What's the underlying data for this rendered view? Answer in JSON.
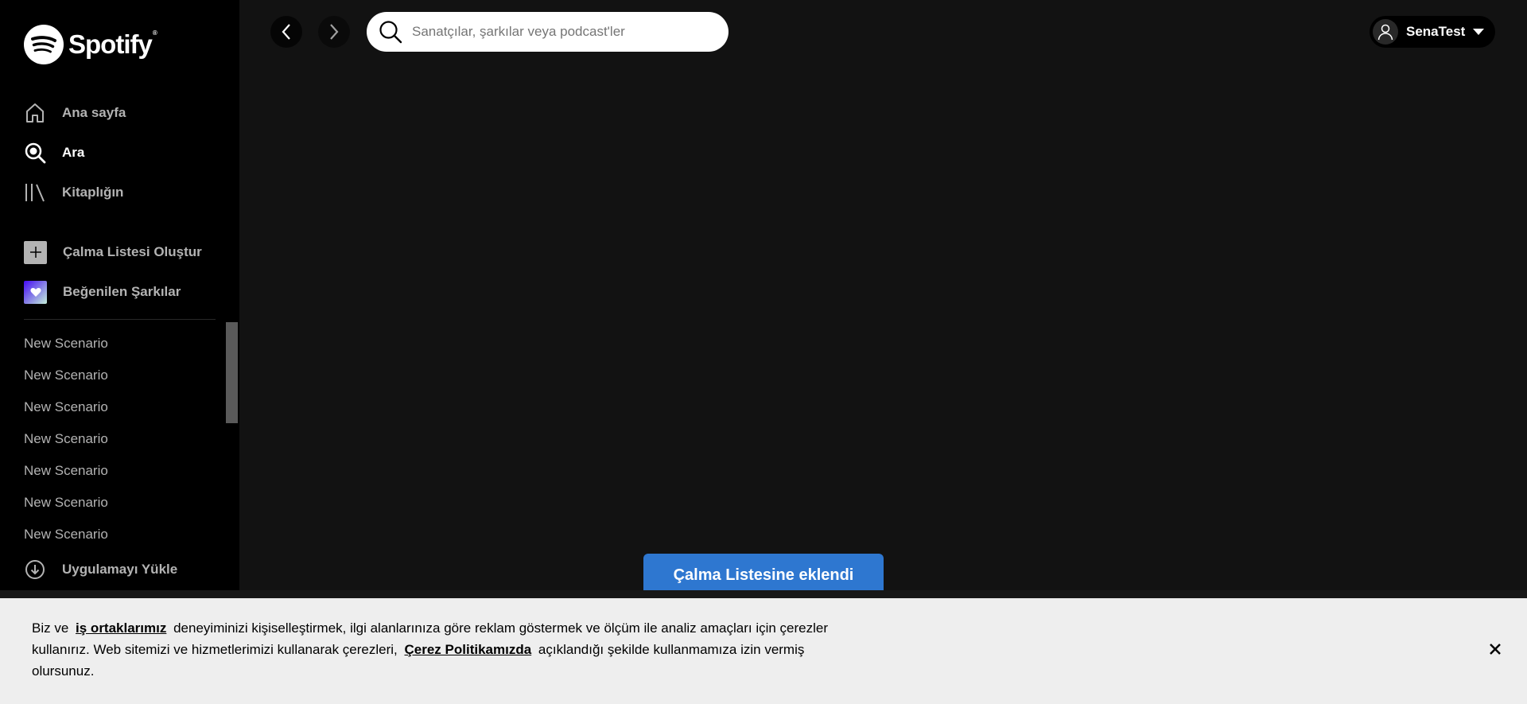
{
  "brand": {
    "name": "Spotify",
    "trademark": "®"
  },
  "sidebar": {
    "nav": [
      {
        "label": "Ana sayfa",
        "icon": "home-icon"
      },
      {
        "label": "Ara",
        "icon": "search-icon"
      },
      {
        "label": "Kitaplığın",
        "icon": "library-icon"
      }
    ],
    "actions": [
      {
        "label": "Çalma Listesi Oluştur",
        "icon": "plus-icon"
      },
      {
        "label": "Beğenilen Şarkılar",
        "icon": "heart-icon"
      }
    ],
    "playlists": [
      "New Scenario",
      "New Scenario",
      "New Scenario",
      "New Scenario",
      "New Scenario",
      "New Scenario",
      "New Scenario"
    ],
    "install_label": "Uygulamayı Yükle"
  },
  "topbar": {
    "search_placeholder": "Sanatçılar, şarkılar veya podcast'ler",
    "user_name": "SenaTest"
  },
  "toast": {
    "message": "Çalma Listesine eklendi"
  },
  "cookie": {
    "part1": "Biz ve",
    "link1": "iş ortaklarımız",
    "part2": "deneyiminizi kişiselleştirmek, ilgi alanlarınıza göre reklam göstermek ve ölçüm ile analiz amaçları için çerezler kullanırız. Web sitemizi ve hizmetlerimizi kullanarak çerezleri,",
    "link2": "Çerez Politikamızda",
    "part3": "açıklandığı şekilde kullanmamıza izin vermiş olursunuz."
  },
  "colors": {
    "background": "#121212",
    "sidebar": "#000000",
    "toast": "#2e77d0",
    "cookie_banner": "#eeeeee"
  }
}
